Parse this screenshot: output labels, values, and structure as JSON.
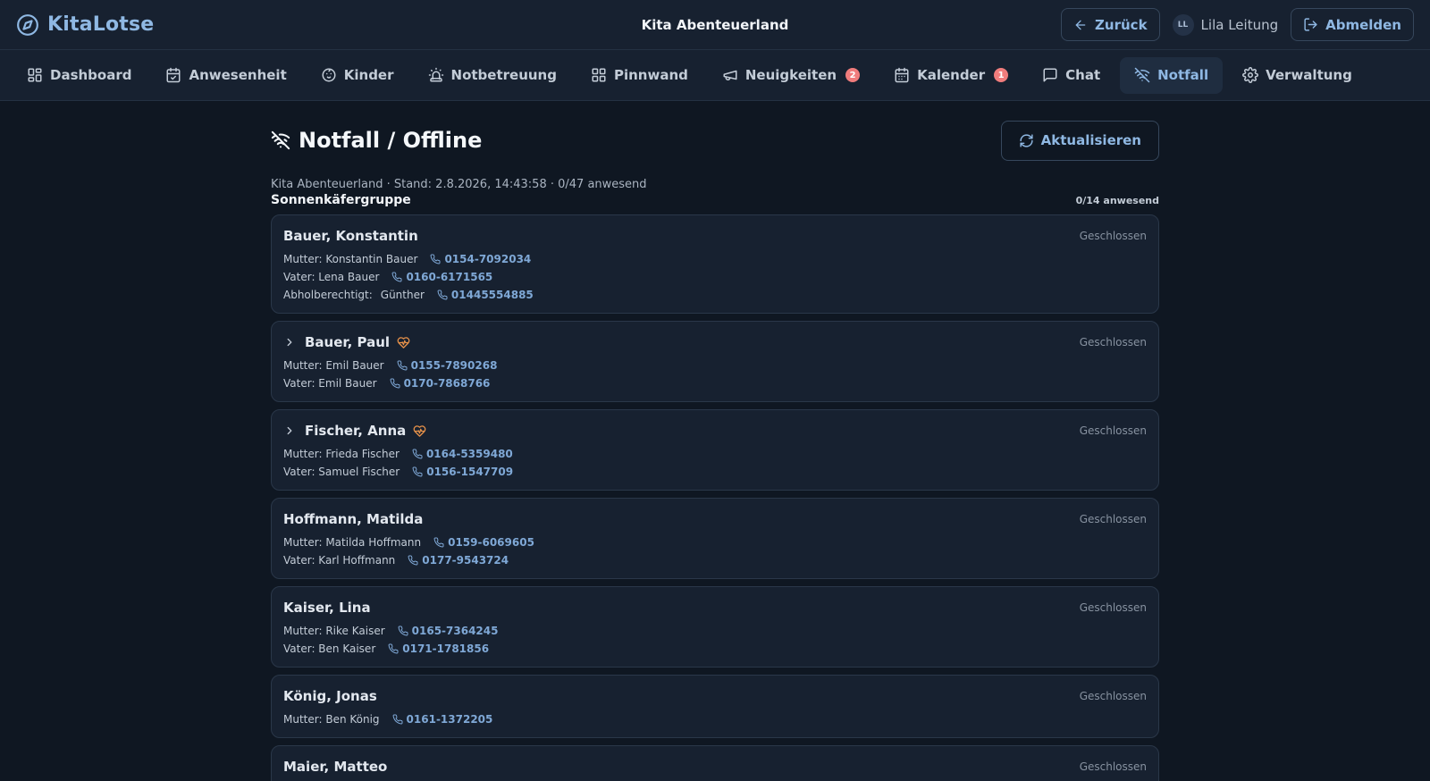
{
  "app": {
    "name": "KitaLotse",
    "kita_title": "Kita Abenteuerland"
  },
  "top_actions": {
    "back_label": "Zurück",
    "user_initials": "LL",
    "user_name": "Lila Leitung",
    "logout_label": "Abmelden"
  },
  "nav": {
    "items": [
      {
        "label": "Dashboard",
        "icon": "dashboard-icon"
      },
      {
        "label": "Anwesenheit",
        "icon": "calendar-check-icon"
      },
      {
        "label": "Kinder",
        "icon": "baby-face-icon"
      },
      {
        "label": "Notbetreuung",
        "icon": "siren-icon"
      },
      {
        "label": "Pinnwand",
        "icon": "grid-icon"
      },
      {
        "label": "Neuigkeiten",
        "icon": "megaphone-icon",
        "badge": "2"
      },
      {
        "label": "Kalender",
        "icon": "calendar-icon",
        "badge": "1"
      },
      {
        "label": "Chat",
        "icon": "chat-icon"
      },
      {
        "label": "Notfall",
        "icon": "wifi-off-icon",
        "active": true
      },
      {
        "label": "Verwaltung",
        "icon": "gear-icon"
      }
    ]
  },
  "page": {
    "title": "Notfall / Offline",
    "refresh_label": "Aktualisieren",
    "meta": "Kita Abenteuerland · Stand: 2.8.2026, 14:43:58 · 0/47 anwesend"
  },
  "group": {
    "name": "Sonnenkäfergruppe",
    "count": "0/14 anwesend",
    "children": [
      {
        "name": "Bauer, Konstantin",
        "status": "Geschlossen",
        "contacts": [
          {
            "who": "Mutter: Konstantin Bauer",
            "phone": "0154-7092034"
          },
          {
            "who": "Vater: Lena Bauer",
            "phone": "0160-6171565"
          },
          {
            "prefix": "Abholberechtigt:",
            "who": "Günther",
            "phone": "01445554885"
          }
        ]
      },
      {
        "name": "Bauer, Paul",
        "status": "Geschlossen",
        "expandable": true,
        "health": true,
        "contacts": [
          {
            "who": "Mutter: Emil Bauer",
            "phone": "0155-7890268"
          },
          {
            "who": "Vater: Emil Bauer",
            "phone": "0170-7868766"
          }
        ]
      },
      {
        "name": "Fischer, Anna",
        "status": "Geschlossen",
        "expandable": true,
        "health": true,
        "contacts": [
          {
            "who": "Mutter: Frieda Fischer",
            "phone": "0164-5359480"
          },
          {
            "who": "Vater: Samuel Fischer",
            "phone": "0156-1547709"
          }
        ]
      },
      {
        "name": "Hoffmann, Matilda",
        "status": "Geschlossen",
        "contacts": [
          {
            "who": "Mutter: Matilda Hoffmann",
            "phone": "0159-6069605"
          },
          {
            "who": "Vater: Karl Hoffmann",
            "phone": "0177-9543724"
          }
        ]
      },
      {
        "name": "Kaiser, Lina",
        "status": "Geschlossen",
        "contacts": [
          {
            "who": "Mutter: Rike Kaiser",
            "phone": "0165-7364245"
          },
          {
            "who": "Vater: Ben Kaiser",
            "phone": "0171-1781856"
          }
        ]
      },
      {
        "name": "König, Jonas",
        "status": "Geschlossen",
        "contacts": [
          {
            "who": "Mutter: Ben König",
            "phone": "0161-1372205"
          }
        ]
      },
      {
        "name": "Maier, Matteo",
        "status": "Geschlossen",
        "contacts": []
      }
    ]
  }
}
